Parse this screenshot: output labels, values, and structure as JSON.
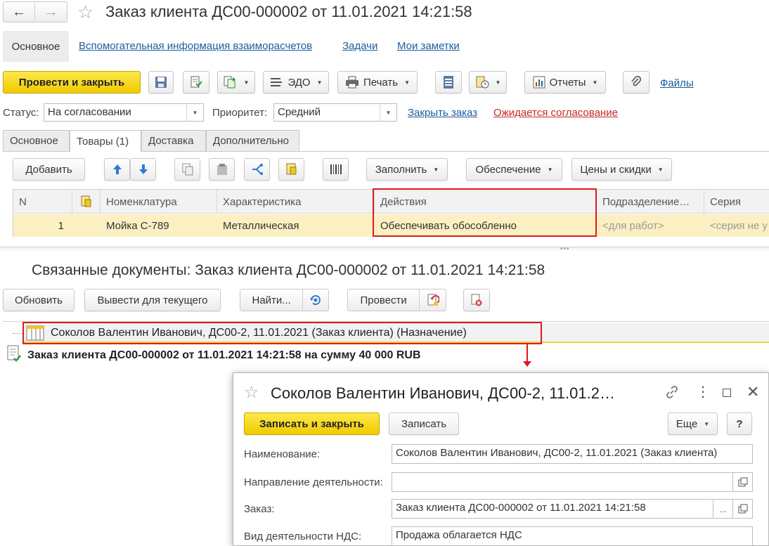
{
  "window": {
    "title": "Заказ клиента ДС00-000002 от 11.01.2021 14:21:58"
  },
  "sections": [
    "Основное",
    "Вспомогательная информация взаиморасчетов",
    "Задачи",
    "Мои заметки"
  ],
  "toolbar": {
    "post_close": "Провести и закрыть",
    "edo": "ЭДО",
    "print": "Печать",
    "reports": "Отчеты",
    "files": "Файлы"
  },
  "status": {
    "status_label": "Статус:",
    "status_value": "На согласовании",
    "priority_label": "Приоритет:",
    "priority_value": "Средний",
    "close_order": "Закрыть заказ",
    "awaiting": "Ожидается согласование"
  },
  "tabs": [
    "Основное",
    "Товары (1)",
    "Доставка",
    "Дополнительно"
  ],
  "goods_toolbar": {
    "add": "Добавить",
    "fill": "Заполнить",
    "provision": "Обеспечение",
    "prices": "Цены и скидки"
  },
  "table": {
    "columns": [
      "N",
      "Номенклатура",
      "Характеристика",
      "Действия",
      "Подразделение…",
      "Серия"
    ],
    "rows": [
      {
        "n": "1",
        "nomenclature": "Мойка С-789",
        "characteristic": "Металлическая",
        "action": "Обеспечивать обособленно",
        "department": "<для работ>",
        "series": "<серия не у"
      }
    ]
  },
  "related": {
    "title": "Связанные документы: Заказ клиента ДС00-000002 от 11.01.2021 14:21:58",
    "refresh": "Обновить",
    "show_for_current": "Вывести для текущего",
    "find": "Найти...",
    "post": "Провести",
    "tree_item_1": "Соколов Валентин Иванович, ДС00-2, 11.01.2021 (Заказ клиента) (Назначение)",
    "tree_item_2": "Заказ клиента ДС00-000002 от 11.01.2021 14:21:58 на сумму 40 000 RUB"
  },
  "popup": {
    "title": "Соколов Валентин Иванович, ДС00-2, 11.01.2…",
    "save_close": "Записать и закрыть",
    "save": "Записать",
    "more": "Еще",
    "help": "?",
    "fields": {
      "name_label": "Наименование:",
      "name_value": "Соколов Валентин Иванович, ДС00-2, 11.01.2021 (Заказ клиента)",
      "direction_label": "Направление деятельности:",
      "direction_value": "",
      "order_label": "Заказ:",
      "order_value": "Заказ клиента ДС00-000002 от 11.01.2021 14:21:58",
      "vat_label": "Вид деятельности НДС:",
      "vat_value": "Продажа облагается НДС"
    }
  },
  "colors": {
    "accent_yellow": "#f5d514",
    "link_blue": "#1c5d9c",
    "link_red": "#c62828",
    "highlight_red": "#e0191e",
    "row_highlight": "#fbf0c2"
  }
}
